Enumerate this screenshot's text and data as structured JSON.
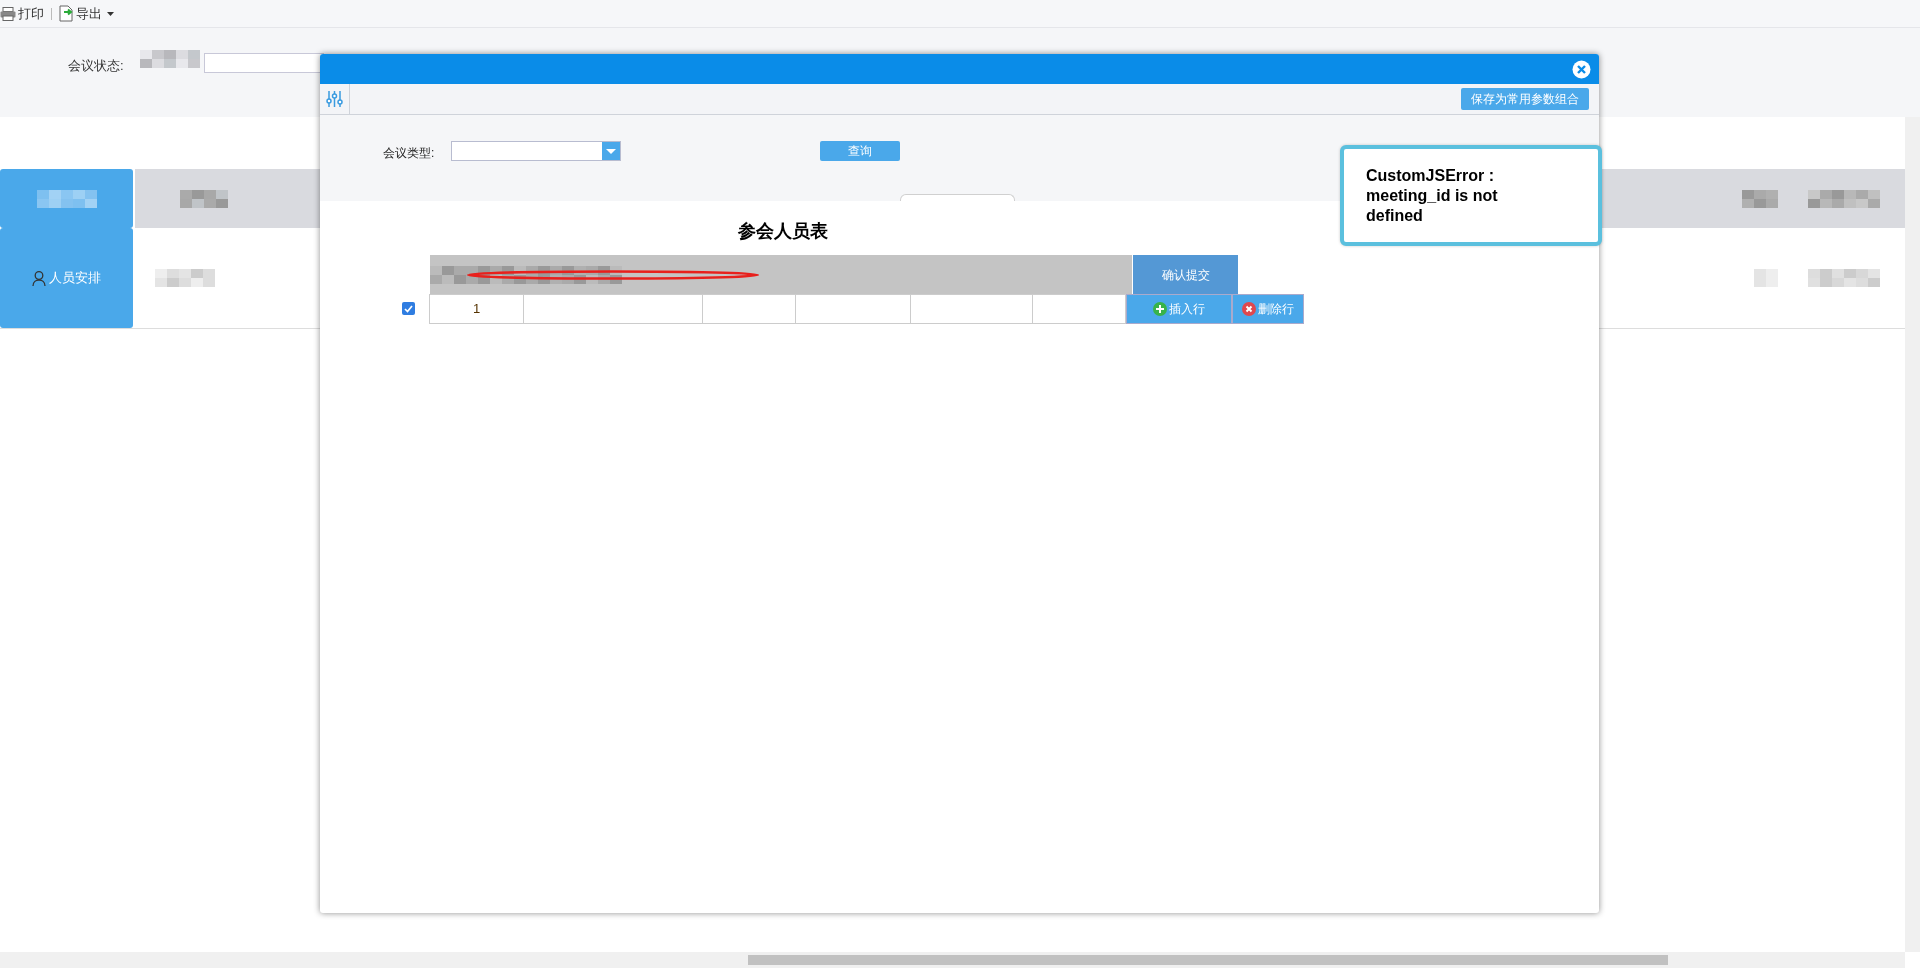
{
  "toolbar": [
    {
      "kind": "print",
      "label": "打印",
      "dropdown": false
    },
    {
      "kind": "export",
      "label": "导出",
      "dropdown": true
    }
  ],
  "filter": {
    "label": "会议状态:"
  },
  "side_buttons": [
    {
      "label": "人员安排"
    }
  ],
  "dialog": {
    "save_button": "保存为常用参数组合",
    "filter_label": "会议类型:",
    "query_button": "查询",
    "table_title": "参会人员表",
    "confirm_button": "确认提交",
    "rows": [
      {
        "checked": true,
        "number": "1"
      }
    ],
    "row_actions": [
      {
        "kind": "insert",
        "label": "插入行"
      },
      {
        "kind": "delete",
        "label": "删除行"
      }
    ]
  },
  "error": {
    "text": "CustomJSError : meeting_id is not defined"
  }
}
